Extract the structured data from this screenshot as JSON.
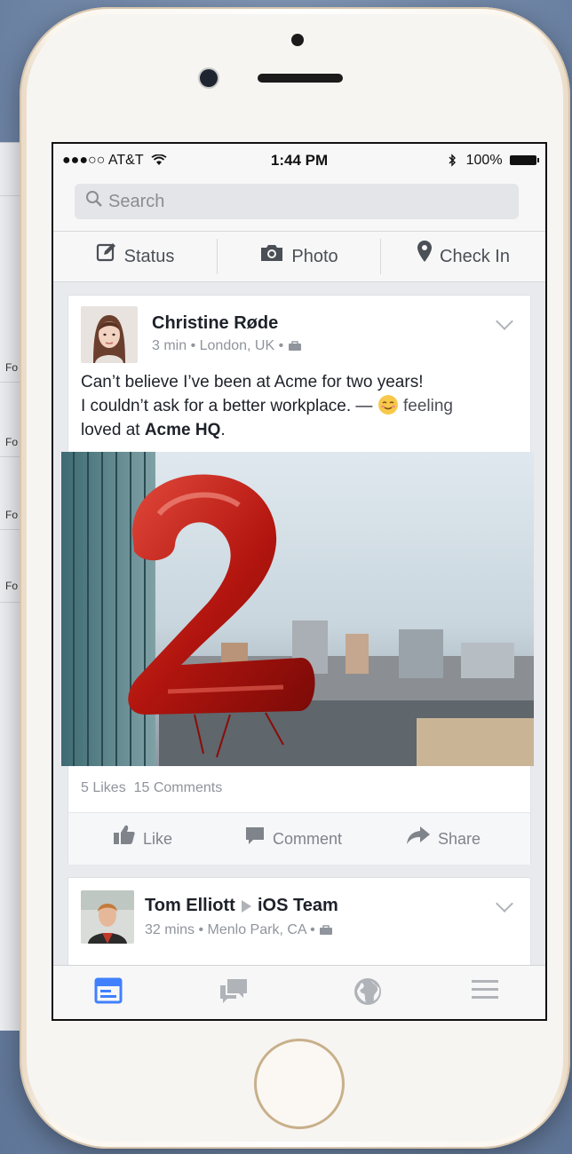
{
  "background_window": {
    "labels": [
      "Fo",
      "Fo",
      "Fo",
      "Fo"
    ]
  },
  "status_bar": {
    "carrier": "●●●○○ AT&T",
    "time": "1:44 PM",
    "battery": "100%"
  },
  "search": {
    "placeholder": "Search"
  },
  "composer": {
    "status_label": "Status",
    "photo_label": "Photo",
    "checkin_label": "Check In"
  },
  "post1": {
    "author": "Christine Røde",
    "meta": "3 min • London, UK •",
    "text_line1": "Can’t believe I’ve been at Acme for two years!",
    "text_line2_prefix": "I couldn’t ask for a better workplace. — ",
    "feeling_word": "feeling",
    "text_line3_prefix": "loved at ",
    "place": "Acme HQ",
    "text_line3_suffix": ".",
    "likes": "5 Likes",
    "comments": "15 Comments",
    "like_label": "Like",
    "comment_label": "Comment",
    "share_label": "Share"
  },
  "post2": {
    "author": "Tom Elliott",
    "group": "iOS Team",
    "meta": "32 mins • Menlo Park, CA •"
  },
  "tabbar": {
    "active": "news-feed",
    "tabs": [
      "news-feed-icon",
      "messages-icon",
      "globe-icon",
      "menu-icon"
    ]
  },
  "colors": {
    "accent": "#4080ff",
    "text": "#1d2129",
    "muted": "#90949c"
  }
}
